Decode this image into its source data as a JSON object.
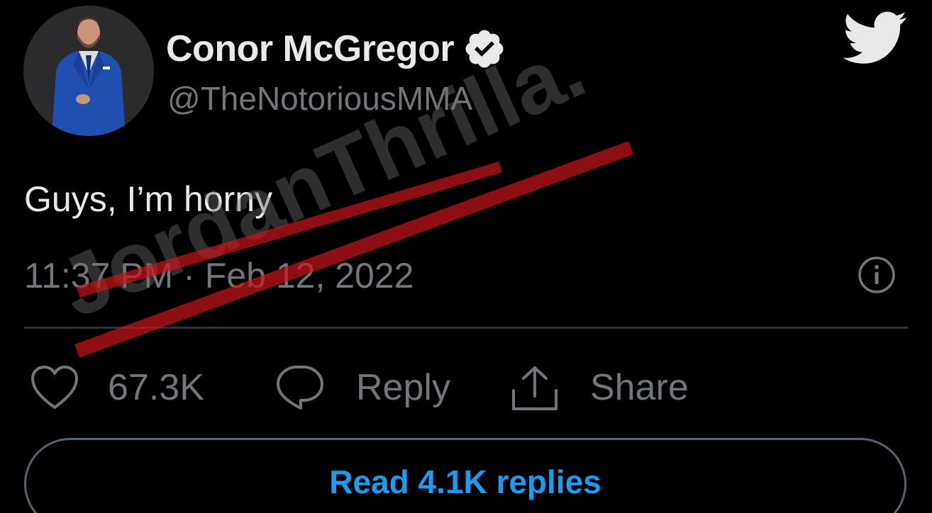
{
  "author": {
    "display_name": "Conor McGregor",
    "handle": "@TheNotoriousMMA",
    "verified_icon": "verified-badge-icon",
    "avatar": "avatar-photo"
  },
  "platform_icon": "twitter-bird-icon",
  "tweet": {
    "text": "Guys, I’m horny",
    "time": "11:37 PM",
    "separator": "·",
    "date": "Feb 12, 2022"
  },
  "actions": {
    "like": {
      "icon": "heart-icon",
      "label": "67.3K"
    },
    "reply": {
      "icon": "speech-bubble-icon",
      "label": "Reply"
    },
    "share": {
      "icon": "share-upload-icon",
      "label": "Share"
    }
  },
  "read_replies_label": "Read 4.1K replies",
  "watermark_text": "JordanThrilla.",
  "colors": {
    "background": "#000000",
    "primary_text": "#e7e9ea",
    "secondary_text": "#71767b",
    "accent": "#1d9bf0",
    "watermark_red": "#c4161c"
  }
}
